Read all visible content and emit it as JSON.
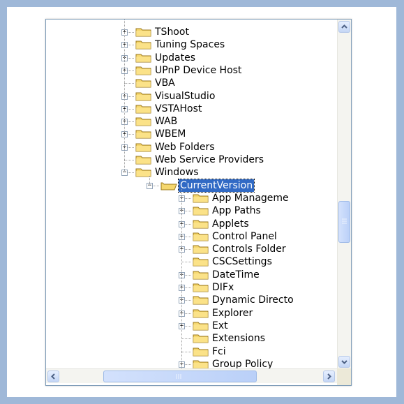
{
  "tree": {
    "top_items": [
      {
        "label": "TShoot",
        "expandable": true
      },
      {
        "label": "Tuning Spaces",
        "expandable": true
      },
      {
        "label": "Updates",
        "expandable": true
      },
      {
        "label": "UPnP Device Host",
        "expandable": true
      },
      {
        "label": "VBA",
        "expandable": false
      },
      {
        "label": "VisualStudio",
        "expandable": true
      },
      {
        "label": "VSTAHost",
        "expandable": true
      },
      {
        "label": "WAB",
        "expandable": true
      },
      {
        "label": "WBEM",
        "expandable": true
      },
      {
        "label": "Web Folders",
        "expandable": true
      },
      {
        "label": "Web Service Providers",
        "expandable": false
      },
      {
        "label": "Windows",
        "expandable": true,
        "expanded": true
      }
    ],
    "selected": {
      "label": "CurrentVersion",
      "expanded": true
    },
    "child_items": [
      {
        "label": "App Manageme",
        "expandable": true
      },
      {
        "label": "App Paths",
        "expandable": true
      },
      {
        "label": "Applets",
        "expandable": true
      },
      {
        "label": "Control Panel",
        "expandable": true
      },
      {
        "label": "Controls Folder",
        "expandable": true
      },
      {
        "label": "CSCSettings",
        "expandable": false
      },
      {
        "label": "DateTime",
        "expandable": true
      },
      {
        "label": "DIFx",
        "expandable": true
      },
      {
        "label": "Dynamic Directo",
        "expandable": true
      },
      {
        "label": "Explorer",
        "expandable": true
      },
      {
        "label": "Ext",
        "expandable": true
      },
      {
        "label": "Extensions",
        "expandable": false
      },
      {
        "label": "Fci",
        "expandable": false
      },
      {
        "label": "Group Policy",
        "expandable": true
      }
    ]
  },
  "scrollbars": {
    "vertical_position": 0.5,
    "horizontal_position": 0.0
  },
  "colors": {
    "background": "#9fb8d8",
    "selection": "#316ac5",
    "folder": "#f5d76e"
  }
}
